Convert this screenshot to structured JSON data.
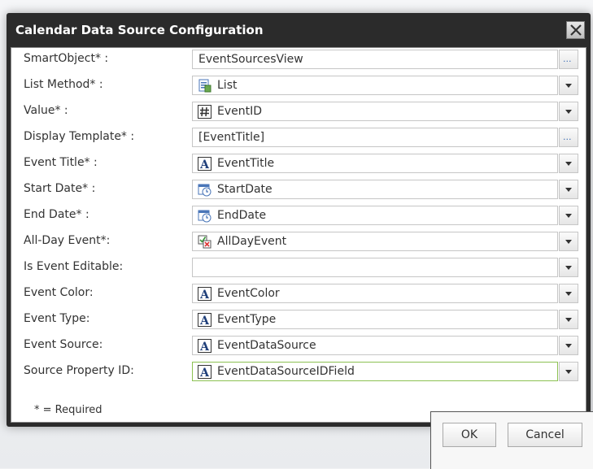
{
  "dialog": {
    "title": "Calendar Data Source Configuration"
  },
  "fields": [
    {
      "label": "SmartObject* :",
      "value": "EventSourcesView",
      "icon": "",
      "control": "ellipsis"
    },
    {
      "label": "List Method* :",
      "value": "List",
      "icon": "list-method-icon",
      "control": "dropdown"
    },
    {
      "label": "Value* :",
      "value": "EventID",
      "icon": "number-type-icon",
      "control": "dropdown"
    },
    {
      "label": "Display Template* :",
      "value": "[EventTitle]",
      "icon": "",
      "control": "ellipsis"
    },
    {
      "label": "Event Title* :",
      "value": "EventTitle",
      "icon": "text-type-icon",
      "control": "dropdown"
    },
    {
      "label": "Start Date* :",
      "value": "StartDate",
      "icon": "datetime-type-icon",
      "control": "dropdown"
    },
    {
      "label": "End Date* :",
      "value": "EndDate",
      "icon": "datetime-type-icon",
      "control": "dropdown"
    },
    {
      "label": "All-Day Event*:",
      "value": "AllDayEvent",
      "icon": "yesno-type-icon",
      "control": "dropdown"
    },
    {
      "label": "Is Event Editable:",
      "value": "",
      "icon": "",
      "control": "dropdown"
    },
    {
      "label": "Event Color:",
      "value": "EventColor",
      "icon": "text-type-icon",
      "control": "dropdown"
    },
    {
      "label": "Event Type:",
      "value": "EventType",
      "icon": "text-type-icon",
      "control": "dropdown"
    },
    {
      "label": "Event Source:",
      "value": "EventDataSource",
      "icon": "text-type-icon",
      "control": "dropdown"
    },
    {
      "label": "Source Property ID:",
      "value": "EventDataSourceIDField",
      "icon": "text-type-icon",
      "control": "dropdown",
      "active": true
    }
  ],
  "required_note": "* = Required",
  "buttons": {
    "ok": "OK",
    "cancel": "Cancel"
  },
  "ellipsis_glyph": "...",
  "colors": {
    "titlebar": "#2b2b2b",
    "active_border": "#8cc152",
    "field_border": "#c6c6c6"
  }
}
